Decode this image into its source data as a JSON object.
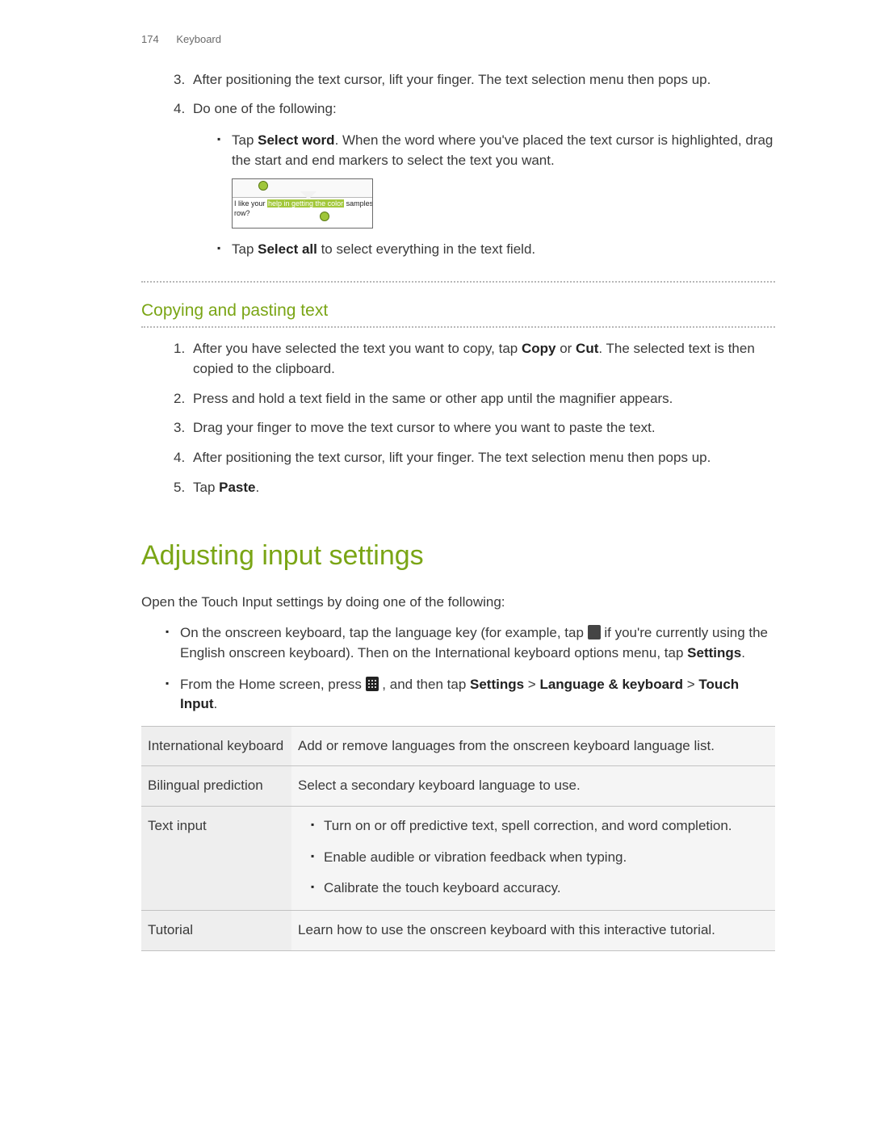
{
  "header": {
    "page_number": "174",
    "section": "Keyboard"
  },
  "list1": {
    "item3_num": "3.",
    "item3_text": "After positioning the text cursor, lift your finger. The text selection menu then pops up.",
    "item4_num": "4.",
    "item4_text": "Do one of the following:",
    "sub1_pre": "Tap ",
    "sub1_b": "Select word",
    "sub1_post": ". When the word where you've placed the text cursor is highlighted, drag the start and end markers to select the text you want.",
    "sub2_pre": "Tap ",
    "sub2_b": "Select all",
    "sub2_post": " to select everything in the text field."
  },
  "screenshot": {
    "pre": "I like your ",
    "highlight": "help in getting the color",
    "post": " samples",
    "line2": "row?"
  },
  "section_copy_title": "Copying and pasting text",
  "list2": {
    "i1_num": "1.",
    "i1_a": "After you have selected the text you want to copy, tap ",
    "i1_b1": "Copy",
    "i1_mid": " or ",
    "i1_b2": "Cut",
    "i1_c": ". The selected text is then copied to the clipboard.",
    "i2_num": "2.",
    "i2_text": "Press and hold a text field in the same or other app until the magnifier appears.",
    "i3_num": "3.",
    "i3_text": "Drag your finger to move the text cursor to where you want to paste the text.",
    "i4_num": "4.",
    "i4_text": "After positioning the text cursor, lift your finger. The text selection menu then pops up.",
    "i5_num": "5.",
    "i5_a": "Tap ",
    "i5_b": "Paste",
    "i5_c": "."
  },
  "h1": "Adjusting input settings",
  "intro": "Open the Touch Input settings by doing one of the following:",
  "bullets": {
    "b1_a": "On the onscreen keyboard, tap the language key (for example, tap ",
    "b1_b": " if you're currently using the English onscreen keyboard). Then on the International keyboard options menu, tap ",
    "b1_settings": "Settings",
    "b1_c": ".",
    "b2_a": "From the Home screen, press ",
    "b2_b": " , and then tap ",
    "b2_s1": "Settings",
    "b2_gt1": " > ",
    "b2_s2": "Language & keyboard",
    "b2_gt2": " > ",
    "b2_s3": "Touch Input",
    "b2_c": "."
  },
  "table": {
    "r1_label": "International keyboard",
    "r1_desc": "Add or remove languages from the onscreen keyboard language list.",
    "r2_label": "Bilingual prediction",
    "r2_desc": "Select a secondary keyboard language to use.",
    "r3_label": "Text input",
    "r3_li1": "Turn on or off predictive text, spell correction, and word completion.",
    "r3_li2": "Enable audible or vibration feedback when typing.",
    "r3_li3": "Calibrate the touch keyboard accuracy.",
    "r4_label": "Tutorial",
    "r4_desc": "Learn how to use the onscreen keyboard with this interactive tutorial."
  }
}
